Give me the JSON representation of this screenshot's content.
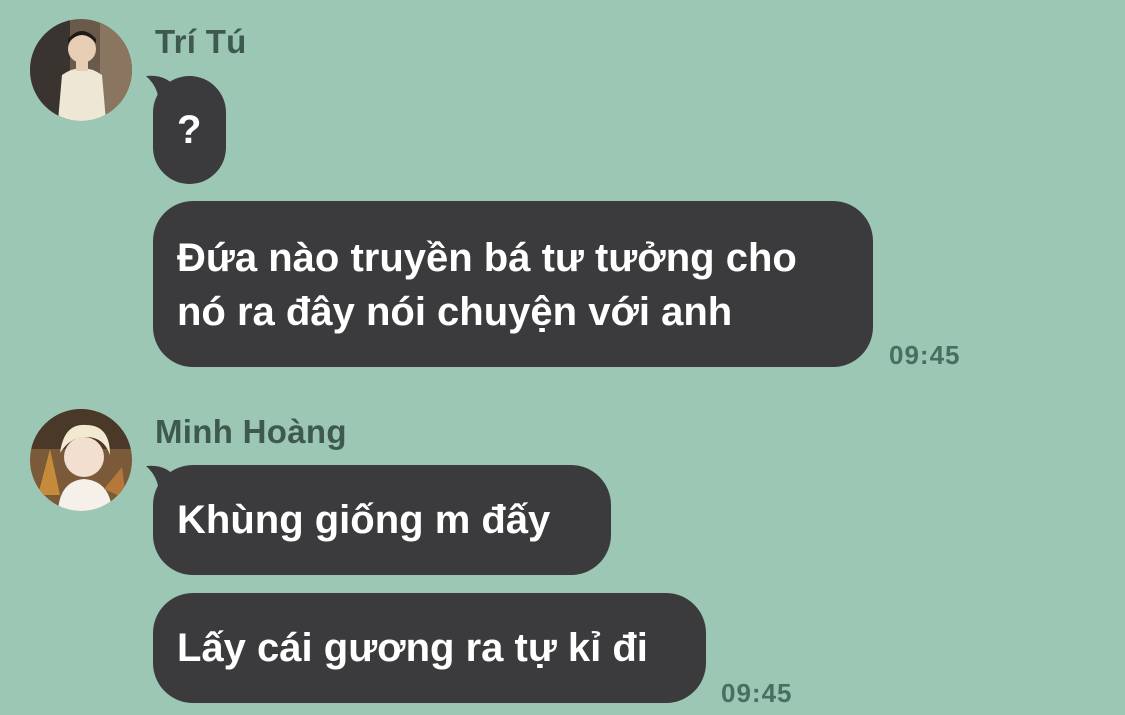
{
  "conversation": {
    "groups": [
      {
        "sender": "Trí Tú",
        "avatar_icon": "profile-photo-man-in-white-sweater",
        "messages": [
          {
            "text": "?"
          },
          {
            "text_lines": [
              "Đứa nào truyền bá tư tưởng cho",
              "nó ra đây nói chuyện với anh"
            ]
          }
        ],
        "time": "09:45"
      },
      {
        "sender": "Minh Hoàng",
        "avatar_icon": "profile-photo-blonde-person",
        "messages": [
          {
            "text": "Khùng giống m đấy"
          },
          {
            "text": "Lấy cái gương ra tự kỉ đi"
          }
        ],
        "time": "09:45"
      }
    ]
  },
  "colors": {
    "background": "#9cc7b5",
    "bubble": "#3b3b3d",
    "bubble_text": "#ffffff",
    "sender_name": "#3e5a4e",
    "timestamp": "#4a6e5f"
  }
}
